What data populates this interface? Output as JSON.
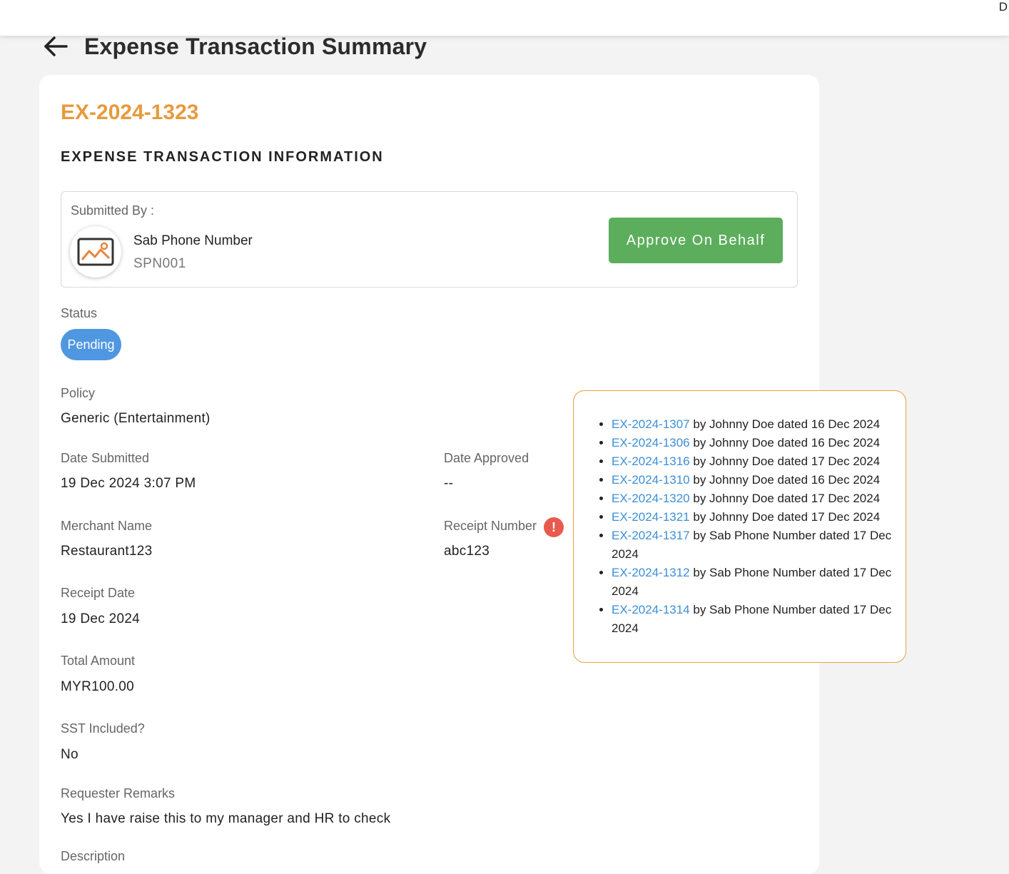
{
  "topbar": {
    "edge_text": "D"
  },
  "header": {
    "title": "Expense Transaction Summary"
  },
  "transaction": {
    "id": "EX-2024-1323",
    "section_title": "EXPENSE TRANSACTION INFORMATION"
  },
  "submitter": {
    "label": "Submitted By :",
    "name": "Sab Phone Number",
    "code": "SPN001",
    "approve_label": "Approve On Behalf",
    "approve_color": "#5cae5c"
  },
  "fields": {
    "status_label": "Status",
    "status_value": "Pending",
    "status_color": "#4f97e0",
    "policy_label": "Policy",
    "policy_value": "Generic (Entertainment)",
    "date_submitted_label": "Date Submitted",
    "date_submitted_value": "19 Dec 2024 3:07 PM",
    "date_approved_label": "Date Approved",
    "date_approved_value": "--",
    "merchant_label": "Merchant Name",
    "merchant_value": "Restaurant123",
    "receipt_number_label": "Receipt Number",
    "receipt_number_value": "abc123",
    "receipt_alert": "!",
    "receipt_date_label": "Receipt Date",
    "receipt_date_value": "19 Dec 2024",
    "total_label": "Total Amount",
    "total_value": "MYR100.00",
    "sst_label": "SST Included?",
    "sst_value": "No",
    "remarks_label": "Requester Remarks",
    "remarks_value": "Yes I have raise this to my manager and HR to check",
    "description_label": "Description"
  },
  "duplicates_popover": {
    "accent": "#e8a040",
    "items": [
      {
        "ref": "EX-2024-1307",
        "text": " by Johnny Doe dated 16 Dec 2024"
      },
      {
        "ref": "EX-2024-1306",
        "text": " by Johnny Doe dated 16 Dec 2024"
      },
      {
        "ref": "EX-2024-1316",
        "text": " by Johnny Doe dated 17 Dec 2024"
      },
      {
        "ref": "EX-2024-1310",
        "text": " by Johnny Doe dated 16 Dec 2024"
      },
      {
        "ref": "EX-2024-1320",
        "text": " by Johnny Doe dated 17 Dec 2024"
      },
      {
        "ref": "EX-2024-1321",
        "text": " by Johnny Doe dated 17 Dec 2024"
      },
      {
        "ref": "EX-2024-1317",
        "text": " by Sab Phone Number dated 17 Dec 2024"
      },
      {
        "ref": "EX-2024-1312",
        "text": " by Sab Phone Number dated 17 Dec 2024"
      },
      {
        "ref": "EX-2024-1314",
        "text": " by Sab Phone Number dated 17 Dec 2024"
      }
    ]
  },
  "icons": {
    "back": "arrow-left-icon",
    "avatar": "image-placeholder-icon",
    "alert": "exclamation-alert-icon"
  }
}
